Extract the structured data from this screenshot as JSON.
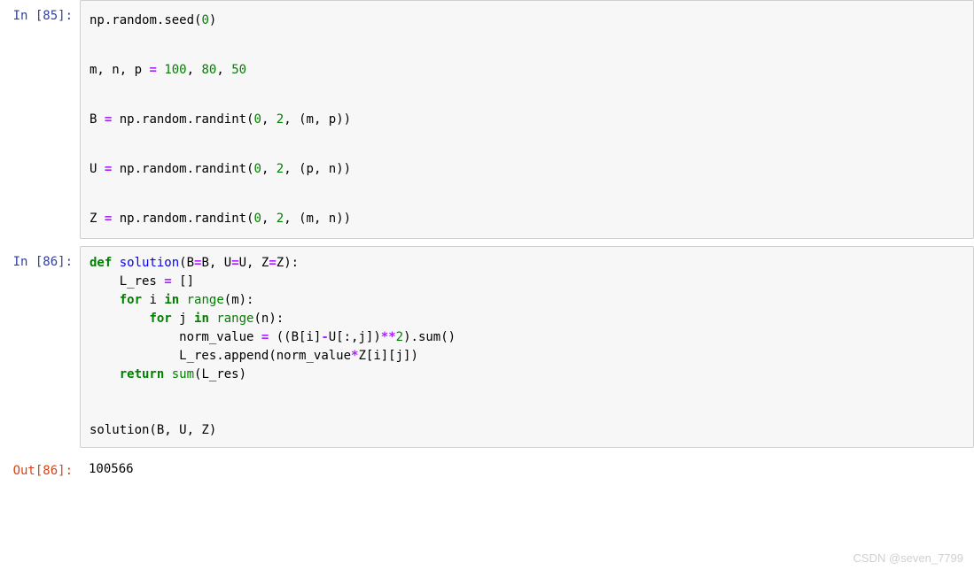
{
  "cells": [
    {
      "prompt": "In  [85]:",
      "type": "in",
      "layout": "loose",
      "code_lines": [
        [
          {
            "text": "np",
            "cls": "t-name"
          },
          {
            "text": ".",
            "cls": "t-punc"
          },
          {
            "text": "random",
            "cls": "t-name"
          },
          {
            "text": ".",
            "cls": "t-punc"
          },
          {
            "text": "seed",
            "cls": "t-name"
          },
          {
            "text": "(",
            "cls": "t-punc"
          },
          {
            "text": "0",
            "cls": "t-num"
          },
          {
            "text": ")",
            "cls": "t-punc"
          }
        ],
        [],
        [
          {
            "text": "m, n, p ",
            "cls": "t-name"
          },
          {
            "text": "=",
            "cls": "t-op"
          },
          {
            "text": " ",
            "cls": "t-name"
          },
          {
            "text": "100",
            "cls": "t-num"
          },
          {
            "text": ", ",
            "cls": "t-punc"
          },
          {
            "text": "80",
            "cls": "t-num"
          },
          {
            "text": ", ",
            "cls": "t-punc"
          },
          {
            "text": "50",
            "cls": "t-num"
          }
        ],
        [],
        [
          {
            "text": "B ",
            "cls": "t-name"
          },
          {
            "text": "=",
            "cls": "t-op"
          },
          {
            "text": " np",
            "cls": "t-name"
          },
          {
            "text": ".",
            "cls": "t-punc"
          },
          {
            "text": "random",
            "cls": "t-name"
          },
          {
            "text": ".",
            "cls": "t-punc"
          },
          {
            "text": "randint",
            "cls": "t-name"
          },
          {
            "text": "(",
            "cls": "t-punc"
          },
          {
            "text": "0",
            "cls": "t-num"
          },
          {
            "text": ", ",
            "cls": "t-punc"
          },
          {
            "text": "2",
            "cls": "t-num"
          },
          {
            "text": ", (m, p))",
            "cls": "t-punc"
          }
        ],
        [],
        [
          {
            "text": "U ",
            "cls": "t-name"
          },
          {
            "text": "=",
            "cls": "t-op"
          },
          {
            "text": " np",
            "cls": "t-name"
          },
          {
            "text": ".",
            "cls": "t-punc"
          },
          {
            "text": "random",
            "cls": "t-name"
          },
          {
            "text": ".",
            "cls": "t-punc"
          },
          {
            "text": "randint",
            "cls": "t-name"
          },
          {
            "text": "(",
            "cls": "t-punc"
          },
          {
            "text": "0",
            "cls": "t-num"
          },
          {
            "text": ", ",
            "cls": "t-punc"
          },
          {
            "text": "2",
            "cls": "t-num"
          },
          {
            "text": ", (p, n))",
            "cls": "t-punc"
          }
        ],
        [],
        [
          {
            "text": "Z ",
            "cls": "t-name"
          },
          {
            "text": "=",
            "cls": "t-op"
          },
          {
            "text": " np",
            "cls": "t-name"
          },
          {
            "text": ".",
            "cls": "t-punc"
          },
          {
            "text": "random",
            "cls": "t-name"
          },
          {
            "text": ".",
            "cls": "t-punc"
          },
          {
            "text": "randint",
            "cls": "t-name"
          },
          {
            "text": "(",
            "cls": "t-punc"
          },
          {
            "text": "0",
            "cls": "t-num"
          },
          {
            "text": ", ",
            "cls": "t-punc"
          },
          {
            "text": "2",
            "cls": "t-num"
          },
          {
            "text": ", (m, n))",
            "cls": "t-punc"
          }
        ]
      ]
    },
    {
      "prompt": "In  [86]:",
      "type": "in",
      "layout": "tight",
      "code_lines": [
        [
          {
            "text": "def",
            "cls": "t-kw"
          },
          {
            "text": " ",
            "cls": "t-name"
          },
          {
            "text": "solution",
            "cls": "t-func"
          },
          {
            "text": "(B",
            "cls": "t-punc"
          },
          {
            "text": "=",
            "cls": "t-op"
          },
          {
            "text": "B, U",
            "cls": "t-punc"
          },
          {
            "text": "=",
            "cls": "t-op"
          },
          {
            "text": "U, Z",
            "cls": "t-punc"
          },
          {
            "text": "=",
            "cls": "t-op"
          },
          {
            "text": "Z):",
            "cls": "t-punc"
          }
        ],
        [
          {
            "text": "    L_res ",
            "cls": "t-name"
          },
          {
            "text": "=",
            "cls": "t-op"
          },
          {
            "text": " []",
            "cls": "t-punc"
          }
        ],
        [
          {
            "text": "    ",
            "cls": "t-name"
          },
          {
            "text": "for",
            "cls": "t-kw"
          },
          {
            "text": " i ",
            "cls": "t-name"
          },
          {
            "text": "in",
            "cls": "t-kw"
          },
          {
            "text": " ",
            "cls": "t-name"
          },
          {
            "text": "range",
            "cls": "t-builtin"
          },
          {
            "text": "(m):",
            "cls": "t-punc"
          }
        ],
        [
          {
            "text": "        ",
            "cls": "t-name"
          },
          {
            "text": "for",
            "cls": "t-kw"
          },
          {
            "text": " j ",
            "cls": "t-name"
          },
          {
            "text": "in",
            "cls": "t-kw"
          },
          {
            "text": " ",
            "cls": "t-name"
          },
          {
            "text": "range",
            "cls": "t-builtin"
          },
          {
            "text": "(n):",
            "cls": "t-punc"
          }
        ],
        [
          {
            "text": "            norm_value ",
            "cls": "t-name"
          },
          {
            "text": "=",
            "cls": "t-op"
          },
          {
            "text": " ((B[i]",
            "cls": "t-punc"
          },
          {
            "text": "-",
            "cls": "t-op"
          },
          {
            "text": "U[:,j])",
            "cls": "t-punc"
          },
          {
            "text": "**",
            "cls": "t-op"
          },
          {
            "text": "2",
            "cls": "t-num"
          },
          {
            "text": ")",
            "cls": "t-punc"
          },
          {
            "text": ".",
            "cls": "t-punc"
          },
          {
            "text": "sum",
            "cls": "t-name"
          },
          {
            "text": "()",
            "cls": "t-punc"
          }
        ],
        [
          {
            "text": "            L_res",
            "cls": "t-name"
          },
          {
            "text": ".",
            "cls": "t-punc"
          },
          {
            "text": "append",
            "cls": "t-name"
          },
          {
            "text": "(norm_value",
            "cls": "t-punc"
          },
          {
            "text": "*",
            "cls": "t-op"
          },
          {
            "text": "Z[i][j])",
            "cls": "t-punc"
          }
        ],
        [
          {
            "text": "    ",
            "cls": "t-name"
          },
          {
            "text": "return",
            "cls": "t-kw"
          },
          {
            "text": " ",
            "cls": "t-name"
          },
          {
            "text": "sum",
            "cls": "t-builtin"
          },
          {
            "text": "(L_res)",
            "cls": "t-punc"
          }
        ],
        [],
        [],
        [
          {
            "text": "solution(B, U, Z)",
            "cls": "t-name"
          }
        ]
      ]
    },
    {
      "prompt": "Out[86]:",
      "type": "out",
      "output": "100566"
    }
  ],
  "watermark": "CSDN @seven_7799"
}
